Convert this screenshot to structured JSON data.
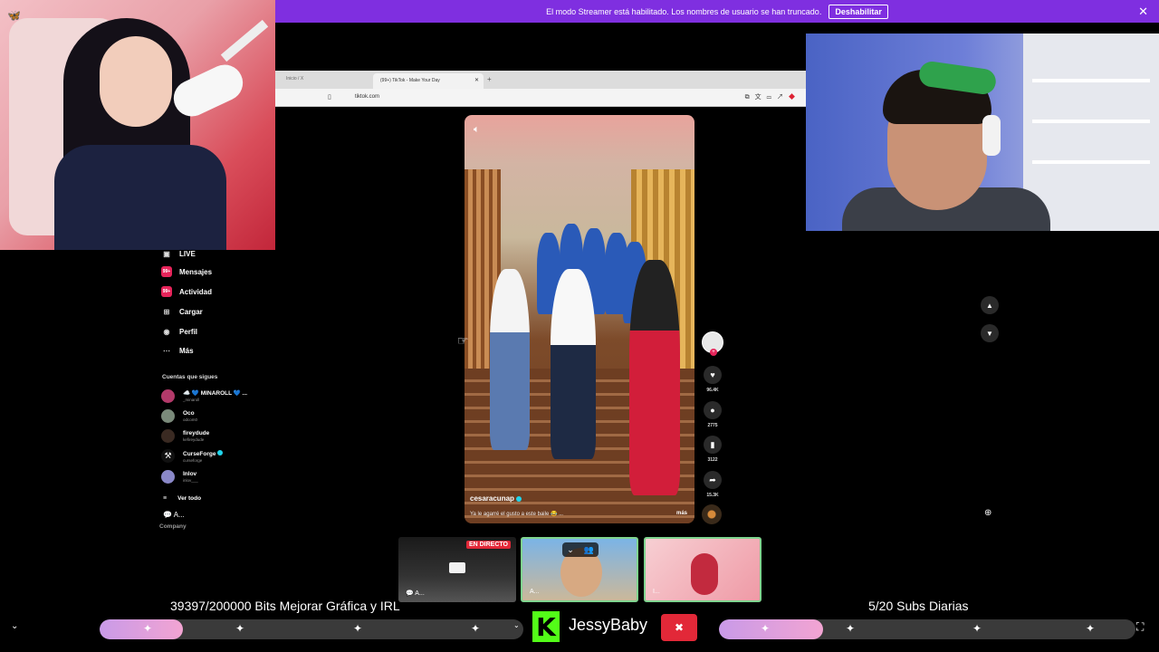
{
  "banner": {
    "text": "El modo Streamer está habilitado. Los nombres de usuario se han truncado.",
    "button": "Deshabilitar",
    "close": "✕"
  },
  "browser": {
    "prev_tab": "Inicio / X",
    "active_tab": "(99+) TikTok - Make Your Day",
    "url": "tiktok.com"
  },
  "sidebar": {
    "items": [
      {
        "label": "LIVE",
        "badge": ""
      },
      {
        "label": "Mensajes",
        "badge": "99+"
      },
      {
        "label": "Actividad",
        "badge": "99+"
      },
      {
        "label": "Cargar",
        "badge": ""
      },
      {
        "label": "Perfil",
        "badge": ""
      },
      {
        "label": "Más",
        "badge": ""
      }
    ],
    "following_title": "Cuentas que sigues",
    "accounts": [
      {
        "name": "☁️ 💙 MINAROLL 💙 ...",
        "handle": "_minaroll",
        "color": "#b33a6a"
      },
      {
        "name": "Oco",
        "handle": "odcom0",
        "color": "#7a8a7a"
      },
      {
        "name": "fireydude",
        "handle": "kefireydude",
        "color": "#3a2a22"
      },
      {
        "name": "CurseForge",
        "handle": "curseforge",
        "color": "#111111"
      },
      {
        "name": "Inlov",
        "handle": "inlov___",
        "color": "#8a88c8"
      }
    ],
    "see_all": "Ver todo",
    "company_short": "A...",
    "company": "Company"
  },
  "video": {
    "username": "cesaracunap",
    "caption": "Ya le agarré el gusto a este baile 😂 ...",
    "more": "más",
    "likes": "96.4K",
    "comments": "2775",
    "saves": "3122",
    "shares": "15.3K"
  },
  "thumbs": {
    "live_badge": "EN DIRECTO",
    "t1_label": "A...",
    "t2_label": "A...",
    "t3_label": "I..."
  },
  "overlay": {
    "bits_goal": "39397/200000 Bits Mejorar Gráfica y IRL",
    "subs_goal": "5/20 Subs Diarias",
    "bits_progress": 0.197,
    "subs_progress": 0.25,
    "kick_name": "JessyBaby"
  },
  "colors": {
    "banner": "#7f2fe0",
    "tiktok_pink": "#e6245a",
    "kick_green": "#53fc18",
    "live_red": "#e22838"
  }
}
